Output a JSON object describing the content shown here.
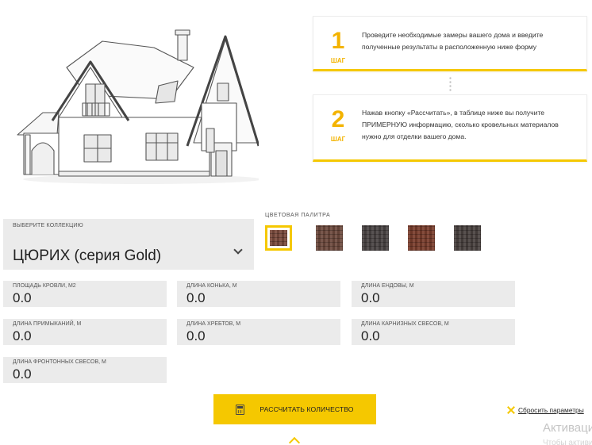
{
  "steps": [
    {
      "number": "1",
      "word": "ШАГ",
      "text": "Проведите необходимые замеры вашего дома и введите полученные результаты в расположенную ниже форму"
    },
    {
      "number": "2",
      "word": "ШАГ",
      "text": "Нажав кнопку «Рассчитать», в таблице ниже вы получите ПРИМЕРНУЮ информацию, сколько кровельных материалов нужно для отделки вашего дома."
    }
  ],
  "collection": {
    "label": "ВЫБЕРИТЕ КОЛЛЕКЦИЮ",
    "value": "ЦЮРИХ (серия Gold)"
  },
  "palette": {
    "label": "ЦВЕТОВАЯ ПАЛИТРА",
    "swatches": [
      {
        "color": "#7a4a3c",
        "selected": true
      },
      {
        "color": "#6e4a3e",
        "selected": false
      },
      {
        "color": "#4a4444",
        "selected": false
      },
      {
        "color": "#7a3d2c",
        "selected": false
      },
      {
        "color": "#4a4240",
        "selected": false
      }
    ]
  },
  "fields": {
    "roof_area": {
      "label": "ПЛОЩАДЬ КРОВЛИ, М2",
      "value": "0.0"
    },
    "ridge_length": {
      "label": "ДЛИНА КОНЬКА, М",
      "value": "0.0"
    },
    "valley_length": {
      "label": "ДЛИНА ЕНДОВЫ, М",
      "value": "0.0"
    },
    "abutment_length": {
      "label": "ДЛИНА ПРИМЫКАНИЙ, М",
      "value": "0.0"
    },
    "hip_length": {
      "label": "ДЛИНА ХРЕБТОВ, М",
      "value": "0.0"
    },
    "eaves_length": {
      "label": "ДЛИНА КАРНИЗНЫХ СВЕСОВ, М",
      "value": "0.0"
    },
    "gable_length": {
      "label": "ДЛИНА ФРОНТОННЫХ СВЕСОВ, М",
      "value": "0.0"
    }
  },
  "actions": {
    "calculate": "РАССЧИТАТЬ КОЛИЧЕСТВО",
    "reset": "Сбросить параметры"
  },
  "watermark": {
    "line1": "Активация",
    "line2": "Чтобы активировать"
  },
  "colors": {
    "accent": "#f5c800",
    "step_number": "#f3b300",
    "field_bg": "#ebebeb"
  }
}
